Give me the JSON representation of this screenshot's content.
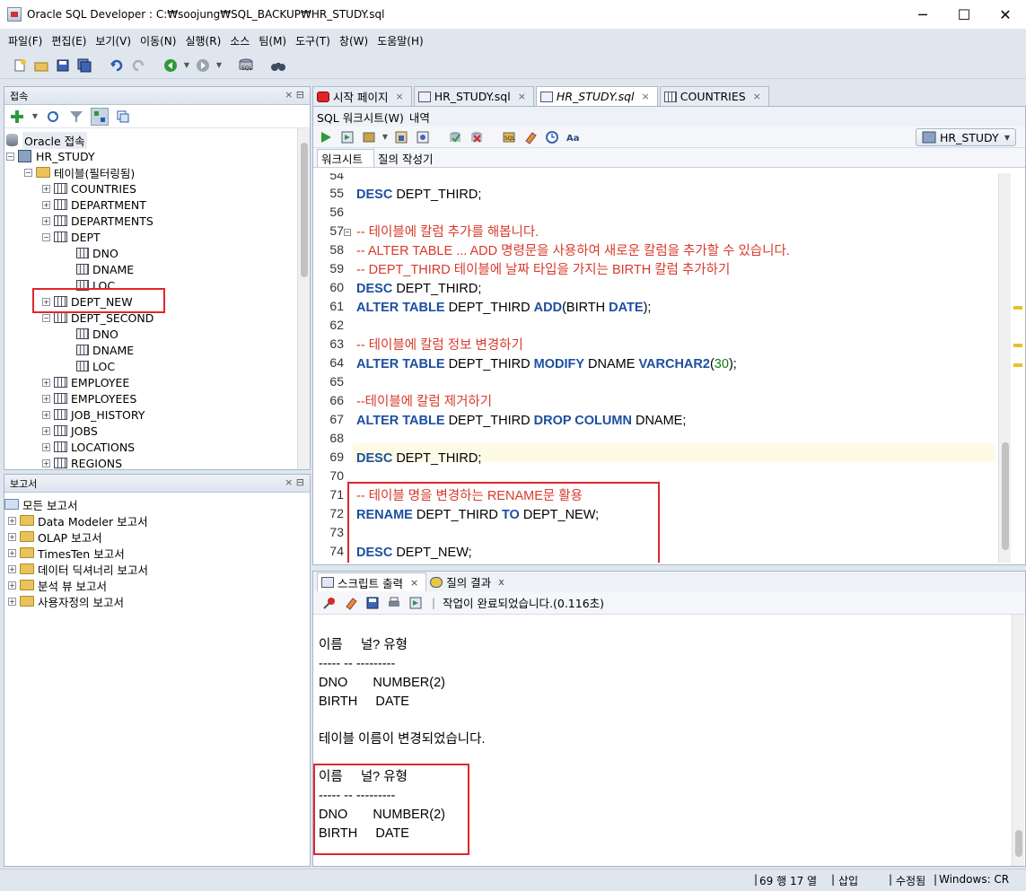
{
  "window": {
    "title": "Oracle SQL Developer : C:₩soojung₩SQL_BACKUP₩HR_STUDY.sql",
    "minimize": "─",
    "maximize": "☐",
    "close": "✕"
  },
  "menu": [
    "파일(F)",
    "편집(E)",
    "보기(V)",
    "이동(N)",
    "실행(R)",
    "소스",
    "팀(M)",
    "도구(T)",
    "창(W)",
    "도움말(H)"
  ],
  "connections_panel": {
    "title": "접속",
    "controls": "×    ⊟",
    "tree": {
      "root": "Oracle 접속",
      "connection": "HR_STUDY",
      "tables_folder": "테이블(필터링됨)",
      "items": [
        "COUNTRIES",
        "DEPARTMENT",
        "DEPARTMENTS",
        "DEPT",
        "DNO",
        "DNAME",
        "LOC",
        "DEPT_NEW",
        "DEPT_SECOND",
        "DNO",
        "DNAME",
        "LOC",
        "EMPLOYEE",
        "EMPLOYEES",
        "JOB_HISTORY",
        "JOBS",
        "LOCATIONS",
        "REGIONS"
      ]
    }
  },
  "reports_panel": {
    "title": "보고서",
    "controls": "×    ⊟",
    "items": [
      "모든 보고서",
      "Data Modeler 보고서",
      "OLAP 보고서",
      "TimesTen 보고서",
      "데이터 딕셔너리 보고서",
      "분석 뷰 보고서",
      "사용자정의 보고서"
    ]
  },
  "doc_tabs": [
    {
      "label": "시작 페이지",
      "close": "×"
    },
    {
      "label": "HR_STUDY.sql",
      "close": "×"
    },
    {
      "label": "HR_STUDY.sql",
      "close": "×"
    },
    {
      "label": "COUNTRIES",
      "close": "×"
    }
  ],
  "editor": {
    "subtabs": {
      "worksheet": "SQL 워크시트(W)",
      "history": "내역"
    },
    "connection_select": "HR_STUDY",
    "ws_tabs": {
      "worksheet": "워크시트",
      "query_builder": "질의 작성기"
    },
    "lines": [
      {
        "n": "54",
        "text": ""
      },
      {
        "n": "55",
        "text": "DESC DEPT_THIRD;"
      },
      {
        "n": "56",
        "text": ""
      },
      {
        "n": "57",
        "text": "-- 테이블에 칼럼 추가를 해봅니다."
      },
      {
        "n": "58",
        "text": "-- ALTER TABLE ... ADD 명령문을 사용하여 새로운 칼럼을 추가할 수 있습니다."
      },
      {
        "n": "59",
        "text": "-- DEPT_THIRD 테이블에 날짜 타입을 가지는 BIRTH 칼럼 추가하기"
      },
      {
        "n": "60",
        "text": "DESC DEPT_THIRD;"
      },
      {
        "n": "61",
        "kw1": "ALTER TABLE",
        "t1": " DEPT_THIRD ",
        "kw2": "ADD",
        "t2": "(BIRTH ",
        "kw3": "DATE",
        "t3": ");"
      },
      {
        "n": "62",
        "text": ""
      },
      {
        "n": "63",
        "text": "-- 테이블에 칼럼 정보 변경하기"
      },
      {
        "n": "64",
        "kw1": "ALTER TABLE",
        "t1": " DEPT_THIRD ",
        "kw2": "MODIFY",
        "t2": " DNAME ",
        "kw3": "VARCHAR2",
        "t3": "(",
        "num": "30",
        "t4": ");"
      },
      {
        "n": "65",
        "text": ""
      },
      {
        "n": "66",
        "text": "--테이블에 칼럼 제거하기"
      },
      {
        "n": "67",
        "kw1": "ALTER TABLE",
        "t1": " DEPT_THIRD ",
        "kw2": "DROP COLUMN",
        "t2": " DNAME;"
      },
      {
        "n": "68",
        "text": ""
      },
      {
        "n": "69",
        "text": "DESC DEPT_THIRD;"
      },
      {
        "n": "70",
        "text": ""
      },
      {
        "n": "71",
        "text": "-- 테이블 명을 변경하는 RENAME문 활용"
      },
      {
        "n": "72",
        "kw1": "RENAME",
        "t1": " DEPT_THIRD ",
        "kw2": "TO",
        "t2": " DEPT_NEW;"
      },
      {
        "n": "73",
        "text": ""
      },
      {
        "n": "74",
        "text": "DESC DEPT_NEW;"
      }
    ],
    "desc_kw": "DESC"
  },
  "output": {
    "tabs": [
      {
        "label": "스크립트 출력",
        "close": "×"
      },
      {
        "label": "질의 결과",
        "close": "x"
      }
    ],
    "status": "작업이 완료되었습니다.(0.116초)",
    "lines": [
      "이름     널? 유형",
      "----- -- ---------",
      "DNO       NUMBER(2)",
      "BIRTH     DATE",
      "",
      "테이블 이름이 변경되었습니다.",
      "",
      "이름     널? 유형",
      "----- -- ---------",
      "DNO       NUMBER(2)",
      "BIRTH     DATE"
    ]
  },
  "statusbar": {
    "position": "69 행 17 열",
    "mode": "삽입",
    "state": "수정됨",
    "eol": "Windows: CR"
  },
  "colors": {
    "accent": "#1d4fa0",
    "comment": "#d83a2a",
    "highlight_box": "#e0262a"
  }
}
